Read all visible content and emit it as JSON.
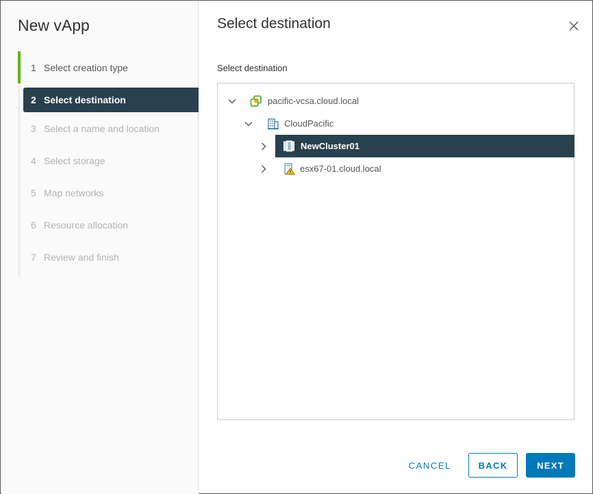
{
  "wizard": {
    "title": "New vApp",
    "steps": [
      {
        "num": "1",
        "label": "Select creation type",
        "state": "completed"
      },
      {
        "num": "2",
        "label": "Select destination",
        "state": "active"
      },
      {
        "num": "3",
        "label": "Select a name and location",
        "state": "disabled"
      },
      {
        "num": "4",
        "label": "Select storage",
        "state": "disabled"
      },
      {
        "num": "5",
        "label": "Map networks",
        "state": "disabled"
      },
      {
        "num": "6",
        "label": "Resource allocation",
        "state": "disabled"
      },
      {
        "num": "7",
        "label": "Review and finish",
        "state": "disabled"
      }
    ]
  },
  "main": {
    "title": "Select destination",
    "section_label": "Select destination",
    "tree": [
      {
        "label": "pacific-vcsa.cloud.local",
        "icon": "vcenter-icon",
        "expanded": true,
        "selected": false
      },
      {
        "label": "CloudPacific",
        "icon": "datacenter-icon",
        "expanded": true,
        "selected": false
      },
      {
        "label": "NewCluster01",
        "icon": "cluster-icon",
        "expanded": false,
        "selected": true
      },
      {
        "label": "esx67-01.cloud.local",
        "icon": "host-warning-icon",
        "expanded": false,
        "selected": false
      }
    ]
  },
  "footer": {
    "cancel_label": "CANCEL",
    "back_label": "BACK",
    "next_label": "NEXT"
  },
  "colors": {
    "accent": "#0079b8",
    "selected_bg": "#29414e",
    "completed": "#60b515"
  }
}
